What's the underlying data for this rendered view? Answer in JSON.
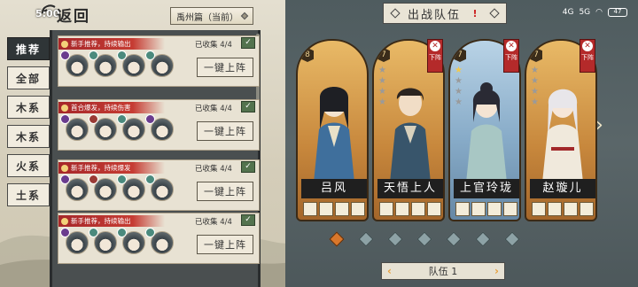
{
  "status": {
    "time": "5:00",
    "signal": "4G",
    "signal2": "5G",
    "battery": "47"
  },
  "header": {
    "back_label": "返回",
    "chapter": "禹州篇（当前）"
  },
  "tabs": [
    {
      "label": "推荐",
      "active": true
    },
    {
      "label": "全部"
    },
    {
      "label": "木系"
    },
    {
      "label": "木系"
    },
    {
      "label": "火系"
    },
    {
      "label": "土系"
    }
  ],
  "cards": [
    {
      "tag": "新手推荐，持续输出",
      "collected": "已收集 4/4",
      "button": "一键上阵"
    },
    {
      "tag": "首合爆发，持续伤害",
      "collected": "已收集 4/4",
      "button": "一键上阵"
    },
    {
      "tag": "新手推荐，持续爆发",
      "collected": "已收集 4/4",
      "button": "一键上阵"
    },
    {
      "tag": "新手推荐，持续输出",
      "collected": "已收集 4/4",
      "button": "一键上阵"
    }
  ],
  "team": {
    "title": "出战队伍",
    "warn": "!",
    "remove_label": "下阵",
    "selector": "队伍 1",
    "heroes": [
      {
        "name": "吕风",
        "level": "8",
        "stars": 0,
        "style": "gold"
      },
      {
        "name": "天悟上人",
        "level": "7",
        "stars": 0,
        "style": "gold"
      },
      {
        "name": "上官玲珑",
        "level": "7",
        "stars": 1,
        "style": "blue"
      },
      {
        "name": "赵璇儿",
        "level": "7",
        "stars": 0,
        "style": "gold"
      }
    ]
  },
  "colors": {
    "accent": "#d9772b",
    "tag_red": "#a6272a",
    "panel_dark": "#4a4f50"
  }
}
